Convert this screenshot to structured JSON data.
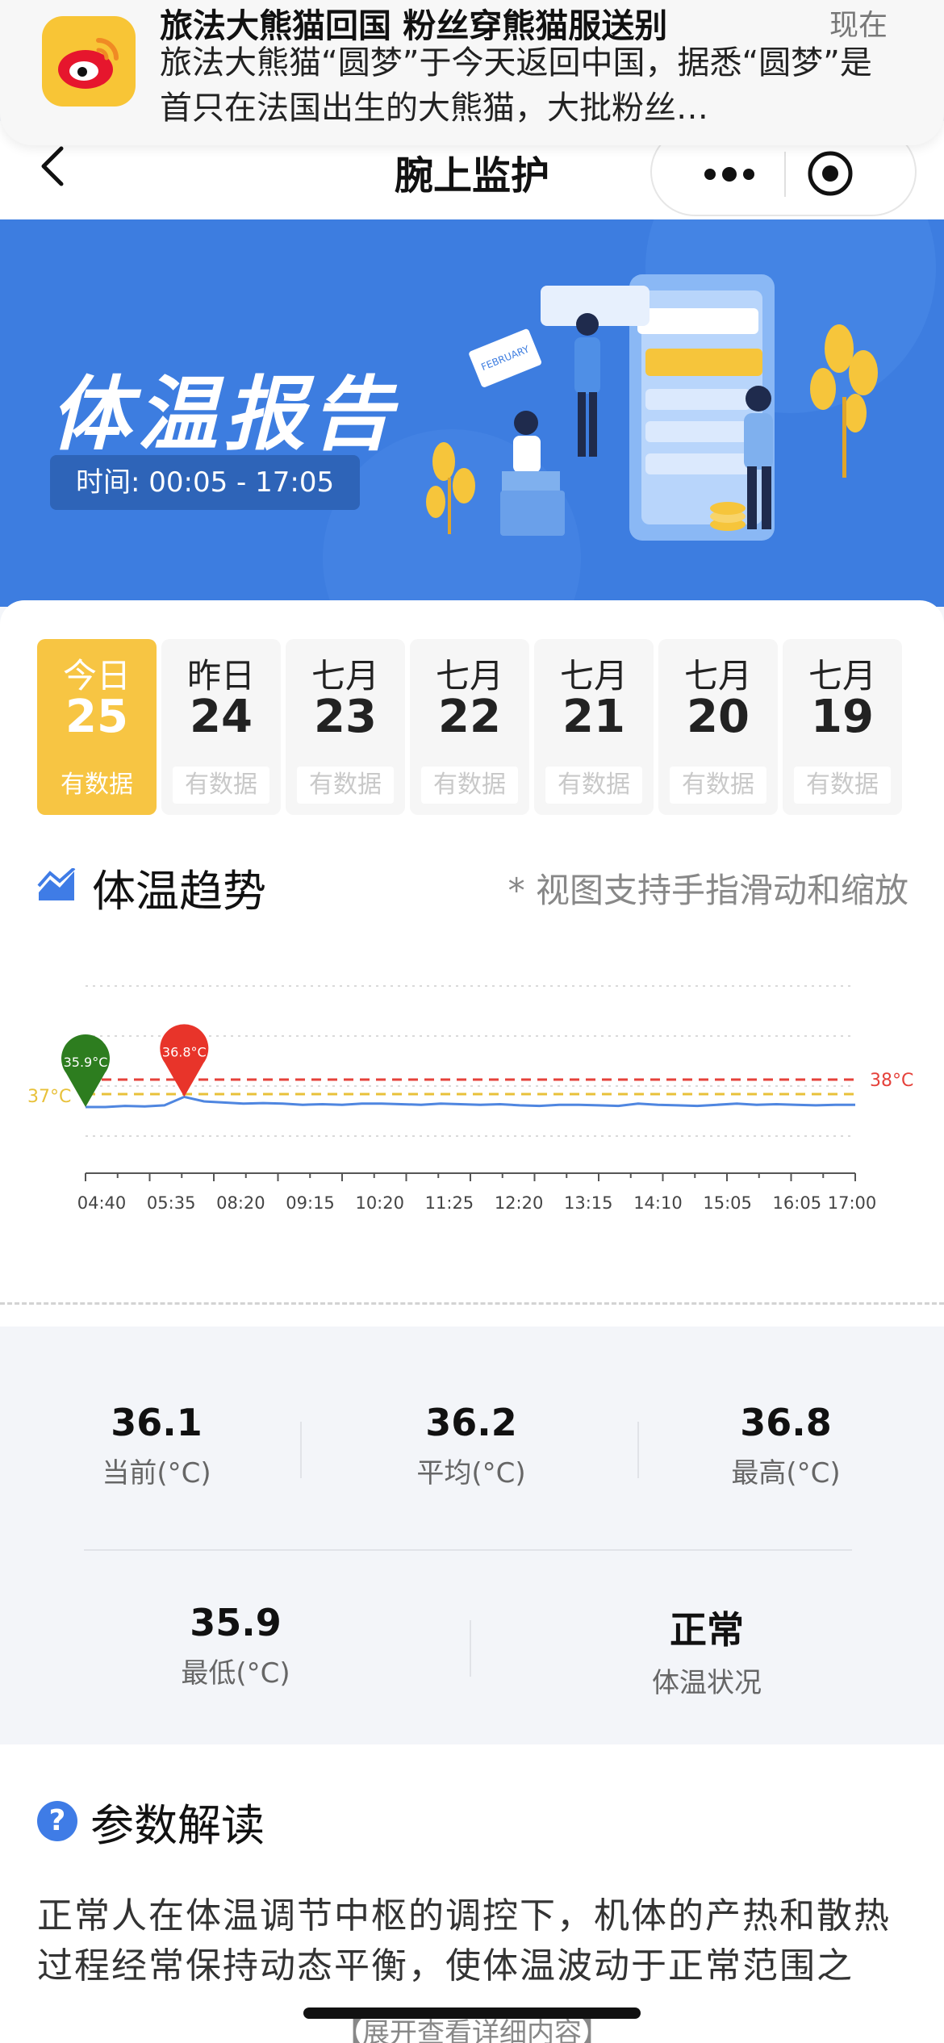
{
  "notification": {
    "title": "旅法大熊猫回国 粉丝穿熊猫服送别",
    "time": "现在",
    "body": "旅法大熊猫“圆梦”于今天返回中国，据悉“圆梦”是首只在法国出生的大熊猫，大批粉丝…",
    "icon": "weibo-icon"
  },
  "navbar": {
    "title": "腕上监护"
  },
  "banner": {
    "title": "体温报告",
    "time": "时间: 00:05 - 17:05",
    "board_text": "FEBRUARY"
  },
  "days": [
    {
      "label": "今日",
      "num": "25",
      "status": "有数据",
      "active": true
    },
    {
      "label": "昨日",
      "num": "24",
      "status": "有数据",
      "active": false
    },
    {
      "label": "七月",
      "num": "23",
      "status": "有数据",
      "active": false
    },
    {
      "label": "七月",
      "num": "22",
      "status": "有数据",
      "active": false
    },
    {
      "label": "七月",
      "num": "21",
      "status": "有数据",
      "active": false
    },
    {
      "label": "七月",
      "num": "20",
      "status": "有数据",
      "active": false
    },
    {
      "label": "七月",
      "num": "19",
      "status": "有数据",
      "active": false
    }
  ],
  "trend": {
    "title": "体温趋势",
    "hint": "* 视图支持手指滑动和缩放"
  },
  "chart_data": {
    "type": "line",
    "x_ticks": [
      "04:40",
      "05:35",
      "08:20",
      "09:15",
      "10:20",
      "11:25",
      "12:20",
      "13:15",
      "14:10",
      "15:05",
      "16:05",
      "17:00"
    ],
    "series": [
      {
        "values": [
          35.9,
          35.9,
          36.0,
          35.95,
          36.05,
          36.8,
          36.4,
          36.3,
          36.2,
          36.25,
          36.2,
          36.1,
          36.15,
          36.1,
          36.2,
          36.2,
          36.15,
          36.1,
          36.2,
          36.15,
          36.1,
          36.15,
          36.05,
          36.0,
          36.1,
          36.1,
          36.05,
          36.0,
          36.2,
          36.1,
          36.05,
          36.0,
          36.1,
          36.2,
          36.1,
          36.15,
          36.1,
          36.05,
          36.1,
          36.1
        ]
      }
    ],
    "threshold_lines": [
      {
        "label": "38°C",
        "value": 38,
        "color": "#e5413a",
        "style": "dashed"
      },
      {
        "label": "37°C",
        "value": 37,
        "color": "#e8c13a",
        "style": "dashed"
      }
    ],
    "markers": [
      {
        "label": "35.9°C",
        "type": "min",
        "color": "#2d7d1f"
      },
      {
        "label": "36.8°C",
        "type": "max",
        "color": "#e8342a"
      }
    ],
    "line_color": "#4f86e0",
    "grid": true
  },
  "stats": {
    "current": {
      "value": "36.1",
      "label": "当前(°C)"
    },
    "average": {
      "value": "36.2",
      "label": "平均(°C)"
    },
    "max": {
      "value": "36.8",
      "label": "最高(°C)"
    },
    "min": {
      "value": "35.9",
      "label": "最低(°C)"
    },
    "status": {
      "value": "正常",
      "label": "体温状况"
    }
  },
  "params": {
    "title": "参数解读",
    "text": "正常人在体温调节中枢的调控下，机体的产热和散热过程经常保持动态平衡，使体温波动于正常范围之",
    "expand": "【展开查看详细内容】"
  },
  "colors": {
    "accent": "#3d7de0",
    "active_day": "#f7c543",
    "line": "#4f86e0"
  }
}
